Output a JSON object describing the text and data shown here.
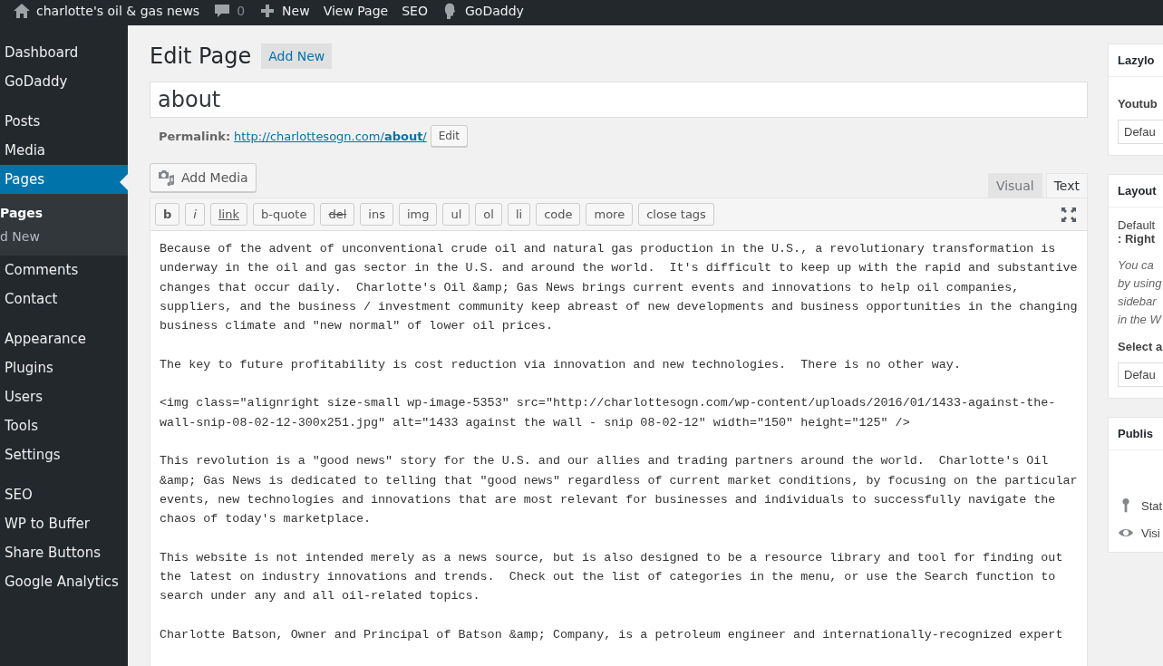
{
  "admin_bar": {
    "site_name": "charlotte's oil & gas news",
    "comments_count": "0",
    "items": [
      "New",
      "View Page",
      "SEO",
      "GoDaddy"
    ]
  },
  "sidebar": {
    "items": [
      {
        "label": "Dashboard",
        "selected": false,
        "group_start": false
      },
      {
        "label": "GoDaddy",
        "selected": false,
        "group_start": false
      },
      {
        "label": "Posts",
        "selected": false,
        "group_start": true
      },
      {
        "label": "Media",
        "selected": false,
        "group_start": false
      },
      {
        "label": "Pages",
        "selected": true,
        "group_start": false,
        "children": [
          {
            "label": "Pages",
            "selected": true
          },
          {
            "label": "d New",
            "selected": false
          }
        ]
      },
      {
        "label": "Comments",
        "selected": false,
        "group_start": false
      },
      {
        "label": "Contact",
        "selected": false,
        "group_start": false
      },
      {
        "label": "Appearance",
        "selected": false,
        "group_start": true
      },
      {
        "label": "Plugins",
        "selected": false,
        "group_start": false
      },
      {
        "label": "Users",
        "selected": false,
        "group_start": false
      },
      {
        "label": "Tools",
        "selected": false,
        "group_start": false
      },
      {
        "label": "Settings",
        "selected": false,
        "group_start": false
      },
      {
        "label": "SEO",
        "selected": false,
        "group_start": true
      },
      {
        "label": "WP to Buffer",
        "selected": false,
        "group_start": false
      },
      {
        "label": "Share Buttons",
        "selected": false,
        "group_start": false
      },
      {
        "label": "Google Analytics",
        "selected": false,
        "group_start": false
      }
    ]
  },
  "heading": "Edit Page",
  "add_new": "Add New",
  "title_value": "about",
  "permalink": {
    "label": "Permalink:",
    "url_base": "http://charlottesogn.com/",
    "slug": "about",
    "trail": "/",
    "edit": "Edit"
  },
  "add_media": "Add Media",
  "editor_tabs": [
    {
      "label": "Visual",
      "selected": false
    },
    {
      "label": "Text",
      "selected": true
    }
  ],
  "quicktags": [
    {
      "label": "b",
      "kind": "bold"
    },
    {
      "label": "i",
      "kind": "italic"
    },
    {
      "label": "link",
      "kind": "underline"
    },
    {
      "label": "b-quote",
      "kind": "plain"
    },
    {
      "label": "del",
      "kind": "strike"
    },
    {
      "label": "ins",
      "kind": "plain"
    },
    {
      "label": "img",
      "kind": "plain"
    },
    {
      "label": "ul",
      "kind": "plain"
    },
    {
      "label": "ol",
      "kind": "plain"
    },
    {
      "label": "li",
      "kind": "plain"
    },
    {
      "label": "code",
      "kind": "plain"
    },
    {
      "label": "more",
      "kind": "plain"
    },
    {
      "label": "close tags",
      "kind": "plain"
    }
  ],
  "content": [
    "Because of the advent of unconventional crude oil and natural gas production in the U.S., a revolutionary transformation is underway in the oil and gas sector in the U.S. and around the world.  It's difficult to keep up with the rapid and substantive changes that occur daily.  Charlotte's Oil &amp; Gas News brings current events and innovations to help oil companies, suppliers, and the business / investment community keep abreast of new developments and business opportunities in the changing business climate and \"new normal\" of lower oil prices.",
    "The key to future profitability is cost reduction via innovation and new technologies.  There is no other way.",
    "<img class=\"alignright size-small wp-image-5353\" src=\"http://charlottesogn.com/wp-content/uploads/2016/01/1433-against-the-wall-snip-08-02-12-300x251.jpg\" alt=\"1433 against the wall - snip 08-02-12\" width=\"150\" height=\"125\" />",
    "This revolution is a \"good news\" story for the U.S. and our allies and trading partners around the world.  Charlotte's Oil &amp; Gas News is dedicated to telling that \"good news\" regardless of current market conditions, by focusing on the particular events, new technologies and innovations that are most relevant for businesses and individuals to successfully navigate the chaos of today's marketplace.",
    "This website is not intended merely as a news source, but is also designed to be a resource library and tool for finding out the latest on industry innovations and trends.  Check out the list of categories in the menu, or use the Search function to search under any and all oil-related topics.",
    "Charlotte Batson, Owner and Principal of Batson &amp; Company, is a petroleum engineer and internationally-recognized expert"
  ],
  "side_boxes": [
    {
      "title": "Lazylo",
      "label": "Youtub",
      "select": "Defau"
    },
    {
      "title": "Layout",
      "text": "Default",
      "value": ": Right",
      "note": [
        "You ca",
        "by using",
        "sidebar",
        "in the W"
      ],
      "label": "Select a",
      "select": "Defau"
    },
    {
      "title": "Publis",
      "rows": [
        {
          "kind": "pin",
          "label": "Stat"
        },
        {
          "kind": "eye",
          "label": "Visi"
        }
      ]
    }
  ]
}
